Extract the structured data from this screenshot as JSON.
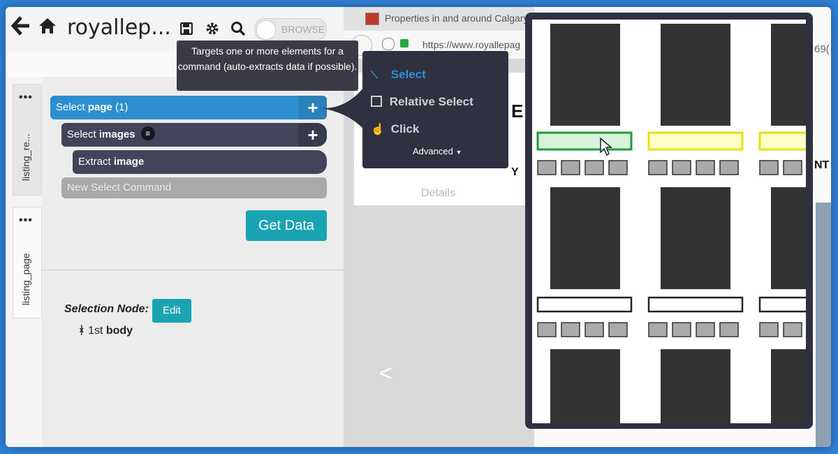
{
  "toolbar": {
    "back_icon": "arrow-left-icon",
    "home_icon": "home-icon",
    "title": "royallep...",
    "save_icon": "save-icon",
    "settings_icon": "gear-icon",
    "search_icon": "search-icon",
    "browse_toggle_label": "BROWSE"
  },
  "tooltip": {
    "text": "Targets one or more elements for a command (auto-extracts data if possible)."
  },
  "side_tabs": [
    {
      "label": "listing_re..."
    },
    {
      "label": "listing_page"
    }
  ],
  "commands": {
    "select_page": {
      "prefix": "Select",
      "target": "page",
      "count": "(1)"
    },
    "select_images": {
      "prefix": "Select",
      "target": "images"
    },
    "extract_image": {
      "prefix": "Extract",
      "target": "image"
    },
    "new_select_placeholder": "New Select Command"
  },
  "get_data_label": "Get Data",
  "selection_node": {
    "label": "Selection Node:",
    "edit_label": "Edit",
    "value_prefix": "1st",
    "value_bold": "body"
  },
  "browser": {
    "tab_title": "Properties in and around Calgary,",
    "url_text": "https://www.royallepag",
    "url_tail": "69(",
    "frag_left_letter": "E",
    "frag_y": "Y",
    "frag_nt": "NT",
    "frag_details": "Details",
    "frag_chevron": "<"
  },
  "dropdown": {
    "items": [
      {
        "label": "Select",
        "icon": "wand-icon",
        "active": true
      },
      {
        "label": "Relative Select",
        "icon": "relative-select-icon",
        "active": false
      },
      {
        "label": "Click",
        "icon": "pointer-hand-icon",
        "active": false
      }
    ],
    "advanced_label": "Advanced"
  },
  "colors": {
    "primary_blue": "#2d8fcf",
    "dark_cmd": "#41445a",
    "teal": "#1aa3b2",
    "dropdown_bg": "#2f3040",
    "active_text": "#2d8fd6",
    "highlight_green": "#1f9b3a",
    "highlight_yellow": "#e6e01b"
  }
}
